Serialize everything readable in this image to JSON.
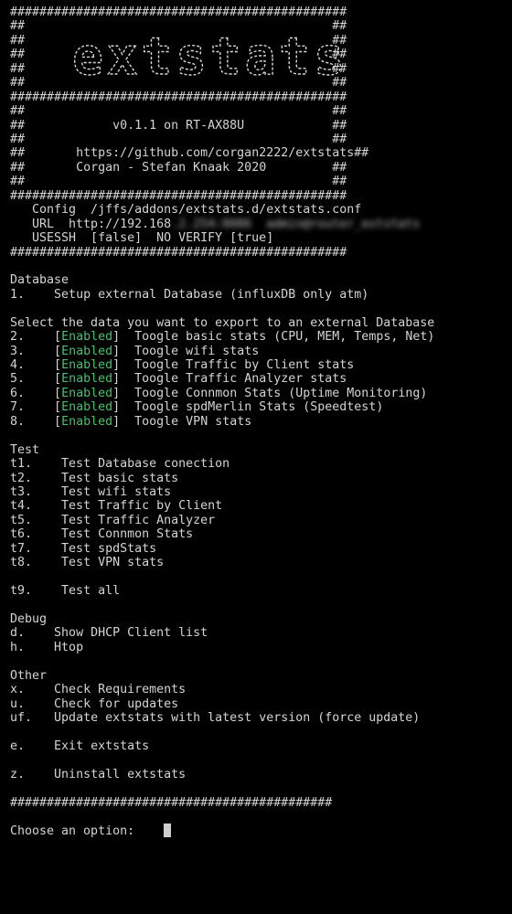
{
  "header": {
    "hash_line": "##############################################",
    "hash_line_short": "############################################",
    "side": "##",
    "logo_text": "extstats",
    "version": "v0.1.1 on RT-AX88U",
    "url": "https://github.com/corgan2222/extstats",
    "author": "Corgan - Stefan Knaak 2020"
  },
  "config": {
    "config_line": "   Config  /jffs/addons/extstats.d/extstats.conf",
    "url_prefix": "   URL  http://192.168",
    "url_blurred": ".2.254:8086  admin@router_extstats",
    "usessh_line": "   USESSH  [false]  NO VERIFY [true]"
  },
  "database": {
    "heading": "Database",
    "item_key": "1.",
    "item_label": "Setup external Database (influxDB only atm)"
  },
  "export": {
    "heading": "Select the data you want to export to an external Database",
    "status_label": "Enabled",
    "items": [
      {
        "key": "2.",
        "label": "Toogle basic stats (CPU, MEM, Temps, Net)"
      },
      {
        "key": "3.",
        "label": "Toogle wifi stats"
      },
      {
        "key": "4.",
        "label": "Toogle Traffic by Client stats"
      },
      {
        "key": "5.",
        "label": "Toogle Traffic Analyzer stats"
      },
      {
        "key": "6.",
        "label": "Toogle Connmon Stats (Uptime Monitoring)"
      },
      {
        "key": "7.",
        "label": "Toogle spdMerlin Stats (Speedtest)"
      },
      {
        "key": "8.",
        "label": "Toogle VPN stats"
      }
    ]
  },
  "test": {
    "heading": "Test",
    "items": [
      {
        "key": "t1.",
        "label": "Test Database conection"
      },
      {
        "key": "t2.",
        "label": "Test basic stats"
      },
      {
        "key": "t3.",
        "label": "Test wifi stats"
      },
      {
        "key": "t4.",
        "label": "Test Traffic by Client"
      },
      {
        "key": "t5.",
        "label": "Test Traffic Analyzer"
      },
      {
        "key": "t6.",
        "label": "Test Connmon Stats"
      },
      {
        "key": "t7.",
        "label": "Test spdStats"
      },
      {
        "key": "t8.",
        "label": "Test VPN stats"
      }
    ],
    "all": {
      "key": "t9.",
      "label": "Test all"
    }
  },
  "debug": {
    "heading": "Debug",
    "items": [
      {
        "key": "d.",
        "label": "Show DHCP Client list"
      },
      {
        "key": "h.",
        "label": "Htop"
      }
    ]
  },
  "other": {
    "heading": "Other",
    "items": [
      {
        "key": "x.",
        "label": "Check Requirements"
      },
      {
        "key": "u.",
        "label": "Check for updates"
      },
      {
        "key": "uf.",
        "label": "Update extstats with latest version (force update)"
      }
    ],
    "exit": {
      "key": "e.",
      "label": "Exit extstats"
    },
    "uninstall": {
      "key": "z.",
      "label": "Uninstall extstats"
    }
  },
  "prompt": {
    "text": "Choose an option:"
  },
  "colors": {
    "background": "#000000",
    "text": "#d4d4d4",
    "enabled": "#43c16b"
  }
}
